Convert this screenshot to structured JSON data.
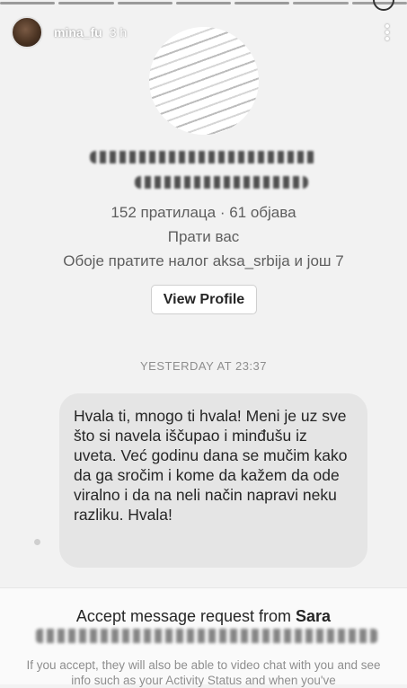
{
  "story": {
    "username": "mina_fu",
    "time": "3 h"
  },
  "profile_card": {
    "stats": "152 пратилаца · 61 објава",
    "follows_you": "Прати вас",
    "mutual": "Обоје пратите налог aksa_srbija и још 7",
    "view_profile_label": "View Profile"
  },
  "conversation": {
    "timestamp": "YESTERDAY AT 23:37",
    "message": "Hvala ti, mnogo ti hvala! Meni je uz sve što si navela iščupao i minđušu iz uveta. Već godinu dana se mučim kako da ga sročim i kome da kažem da ode viralno i da na neli način napravi neku razliku. Hvala!"
  },
  "request": {
    "title_prefix": "Accept message request from ",
    "title_name": "Sara",
    "note": "If you accept, they will also be able to video chat with you and see info such as your Activity Status and when you've"
  },
  "colors": {
    "background": "#f2f2f2",
    "bubble": "#e5e5e5",
    "secondary_text": "#8e8e8e"
  }
}
